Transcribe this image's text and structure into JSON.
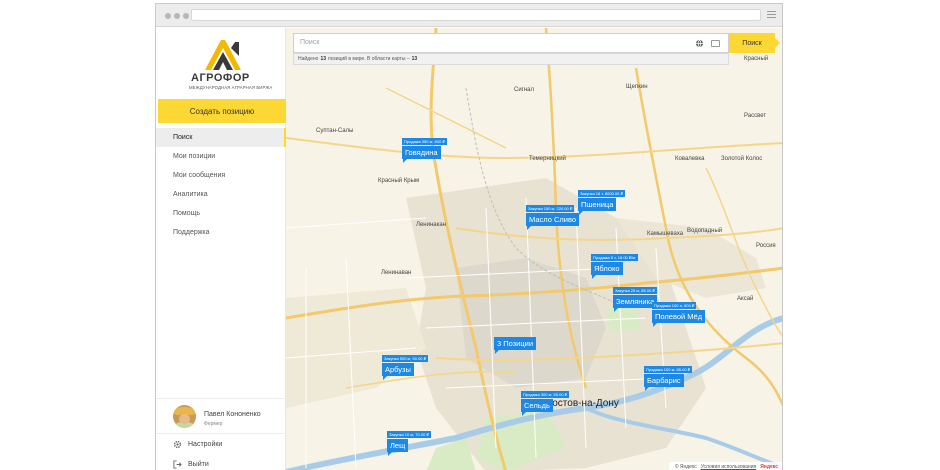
{
  "logo": {
    "name": "АГРОФОР",
    "tagline": "МЕЖДУНАРОДНАЯ АГРАРНАЯ БИРЖА"
  },
  "sidebar": {
    "create_label": "Создать позицию",
    "items": [
      {
        "label": "Поиск",
        "active": true
      },
      {
        "label": "Мои позиции"
      },
      {
        "label": "Мои сообщения"
      },
      {
        "label": "Аналитика"
      },
      {
        "label": "Помощь"
      },
      {
        "label": "Поддержка"
      }
    ],
    "user": {
      "name": "Павел Кононенко",
      "role": "Фермер"
    },
    "settings_label": "Настройки",
    "logout_label": "Выйти"
  },
  "search": {
    "placeholder": "Поиск",
    "button_label": "Поиск",
    "results_text_1": "Найдено",
    "results_count_world": "13",
    "results_text_2": "позиций в мире. В области карты –",
    "results_count_area": "13"
  },
  "map": {
    "places": [
      "Сигнал",
      "Щепкин",
      "Красный",
      "Рассвет",
      "Суптан-Салы",
      "Темерницкий",
      "Ковалевка",
      "Золотой Колос",
      "Красный Крым",
      "Ленинакан",
      "Водопадный",
      "Камышеваха",
      "Ленинаван",
      "Россия",
      "Аксай",
      "Ростов-на-Дону"
    ],
    "markers": [
      {
        "price": "Продажа 350 кг, 800 ₽",
        "name": "Говядина"
      },
      {
        "price": "Закупка 18 т, 8000.00 ₽",
        "name": "Пшеница"
      },
      {
        "price": "Закупка 150 кг, 220.00 ₽",
        "name": "Масло Сливо"
      },
      {
        "price": "Продажа 5 т, 18.00 ₽/кг",
        "name": "Яблоко"
      },
      {
        "price": "Закупка 25 кг, 85.00 ₽",
        "name": "Земляника"
      },
      {
        "price": "Продажа 100 л, 800 ₽",
        "name": "Полевой Мёд"
      },
      {
        "name": "3 Позиции"
      },
      {
        "price": "Закупка 500 кг, 50.00 ₽",
        "name": "Арбузы"
      },
      {
        "price": "Продажа 100 кг, 85.00 ₽",
        "name": "Барбарис"
      },
      {
        "price": "Продажа 300 кг, 55.00 ₽",
        "name": "Сельдь"
      },
      {
        "price": "Закупка 10 кг, 70.00 ₽",
        "name": "Лещ"
      }
    ],
    "footer": {
      "copy": "© Яндекс",
      "terms": "Условия использования",
      "brand": "Яндекс"
    }
  },
  "colors": {
    "accent": "#fdd835",
    "marker": "#1e88e5"
  }
}
